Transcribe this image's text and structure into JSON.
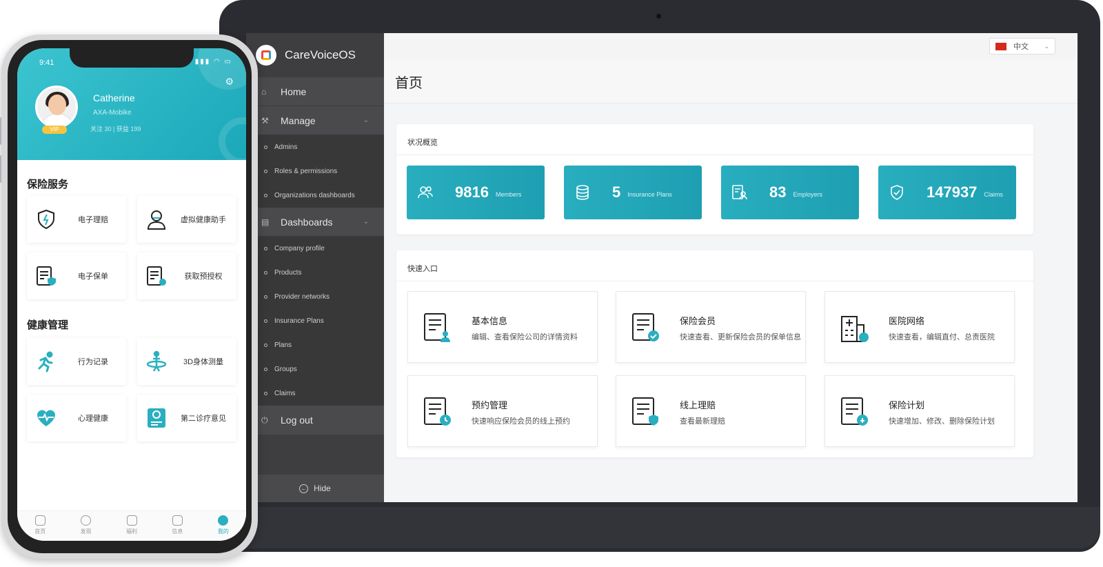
{
  "laptop": {
    "brand": "CareVoiceOS",
    "language": "中文",
    "page_title": "首页",
    "nav": {
      "home": "Home",
      "manage": "Manage",
      "manage_items": [
        "Admins",
        "Roles & permissions",
        "Organizations dashboards"
      ],
      "dashboards": "Dashboards",
      "dashboard_items": [
        "Company profile",
        "Products",
        "Provider networks",
        "Insurance Plans",
        "Plans",
        "Groups",
        "Claims"
      ],
      "logout": "Log out",
      "hide": "Hide"
    },
    "overview": {
      "title": "状况概览",
      "stats": [
        {
          "value": "9816",
          "label": "Members",
          "icon": "members-icon"
        },
        {
          "value": "5",
          "label": "Insurance Plans",
          "icon": "database-icon"
        },
        {
          "value": "83",
          "label": "Employers",
          "icon": "employer-icon"
        },
        {
          "value": "147937",
          "label": "Claims",
          "icon": "shield-icon"
        }
      ]
    },
    "quick": {
      "title": "快速入口",
      "cards": [
        {
          "title": "基本信息",
          "desc": "编辑、查看保险公司的详情资料",
          "icon": "document-user-icon"
        },
        {
          "title": "保险会员",
          "desc": "快速查看、更新保险会员的保单信息",
          "icon": "document-check-icon"
        },
        {
          "title": "医院网络",
          "desc": "快速查看，编辑直付、总责医院",
          "icon": "hospital-icon"
        },
        {
          "title": "预约管理",
          "desc": "快速响应保险会员的线上预约",
          "icon": "document-clock-icon"
        },
        {
          "title": "线上理赔",
          "desc": "查看最新理赔",
          "icon": "document-shield-icon"
        },
        {
          "title": "保险计划",
          "desc": "快速增加、修改、删除保险计划",
          "icon": "document-chart-icon"
        }
      ]
    }
  },
  "phone": {
    "time": "9:41",
    "user": {
      "name": "Catherine",
      "company": "AXA-Mobike",
      "stats": "关注 30   |   获益 199",
      "badge": "VIP"
    },
    "insurance_section": "保险服务",
    "insurance_tiles": [
      {
        "label": "电子理赔",
        "icon": "shield-bolt-icon"
      },
      {
        "label": "虚拟健康助手",
        "icon": "doctor-icon"
      },
      {
        "label": "电子保单",
        "icon": "policy-icon"
      },
      {
        "label": "获取预授权",
        "icon": "authorization-icon"
      }
    ],
    "health_section": "健康管理",
    "health_tiles": [
      {
        "label": "行为记录",
        "icon": "running-icon"
      },
      {
        "label": "3D身体测量",
        "icon": "body-scan-icon"
      },
      {
        "label": "心理健康",
        "icon": "heart-pulse-icon"
      },
      {
        "label": "第二诊疗意见",
        "icon": "second-opinion-icon"
      }
    ],
    "tabs": [
      "首页",
      "发现",
      "福利",
      "信息",
      "我的"
    ],
    "accent": "#2aafc0"
  }
}
